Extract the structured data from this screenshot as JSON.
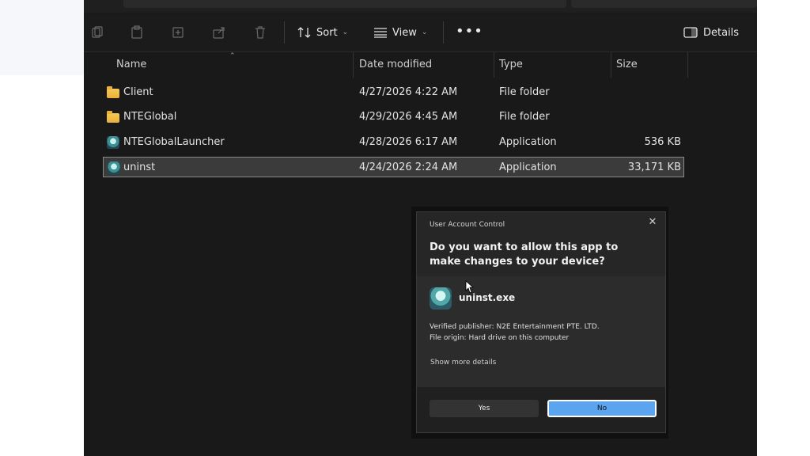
{
  "toolbar": {
    "sort_label": "Sort",
    "view_label": "View",
    "more_label": "•••",
    "details_label": "Details"
  },
  "columns": {
    "name": "Name",
    "date_modified": "Date modified",
    "type": "Type",
    "size": "Size"
  },
  "files": [
    {
      "name": "Client",
      "date": "4/27/2026 4:22 AM",
      "type": "File folder",
      "size": "",
      "icon": "folder-icon"
    },
    {
      "name": "NTEGlobal",
      "date": "4/29/2026 4:45 AM",
      "type": "File folder",
      "size": "",
      "icon": "folder-icon"
    },
    {
      "name": "NTEGlobalLauncher",
      "date": "4/28/2026 6:17 AM",
      "type": "Application",
      "size": "536 KB",
      "icon": "app-icon"
    },
    {
      "name": "uninst",
      "date": "4/24/2026 2:24 AM",
      "type": "Application",
      "size": "33,171 KB",
      "icon": "app-icon"
    }
  ],
  "uac": {
    "title": "User Account Control",
    "question": "Do you want to allow this app to make changes to your device?",
    "app_name": "uninst.exe",
    "publisher": "Verified publisher: N2E Entertainment PTE. LTD.",
    "origin": "File origin: Hard drive on this computer",
    "show_more": "Show more details",
    "yes_label": "Yes",
    "no_label": "No",
    "close_label": "✕"
  },
  "colors": {
    "background": "#191919",
    "selected_row": "#3b3b3b",
    "accent_button": "#5ba5f0"
  }
}
